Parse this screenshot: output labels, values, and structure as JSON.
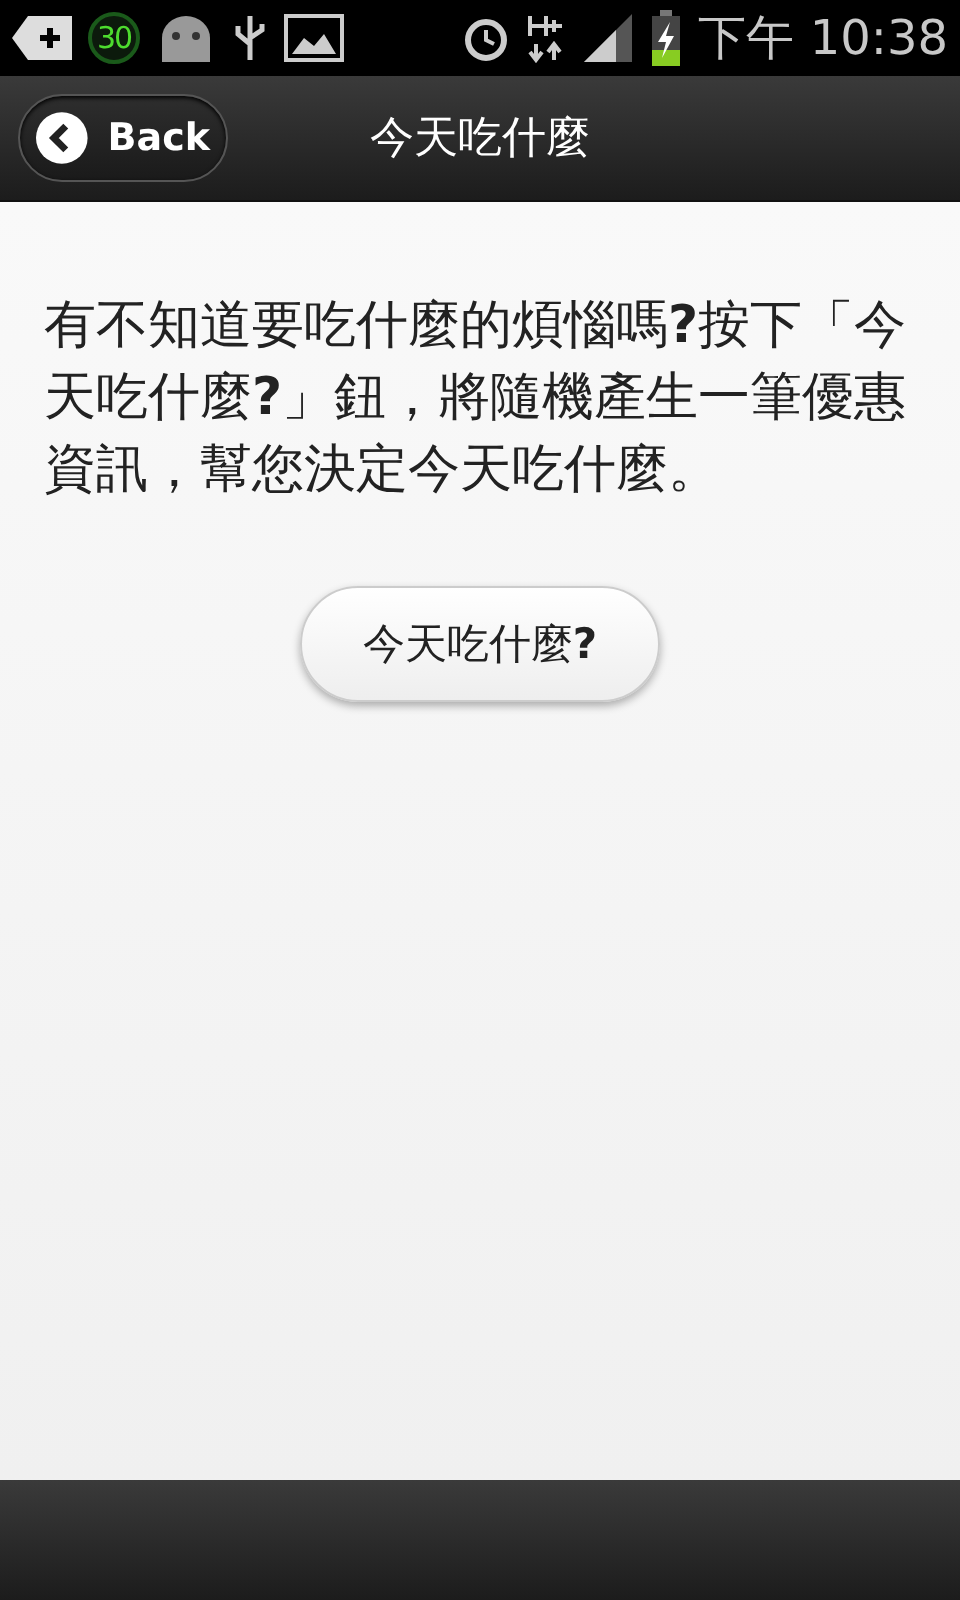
{
  "status_bar": {
    "badge": "30",
    "time": "下午 10:38"
  },
  "header": {
    "back_button": {
      "label": "Back"
    },
    "title": "今天吃什麼"
  },
  "content": {
    "description": "有不知道要吃什麼的煩惱嗎**?**按下「今天吃什麼**?**」鈕，將隨機產生一筆優惠資訊，幫您決定今天吃什麼。",
    "button": {
      "label": "今天吃什麼**?**"
    }
  }
}
